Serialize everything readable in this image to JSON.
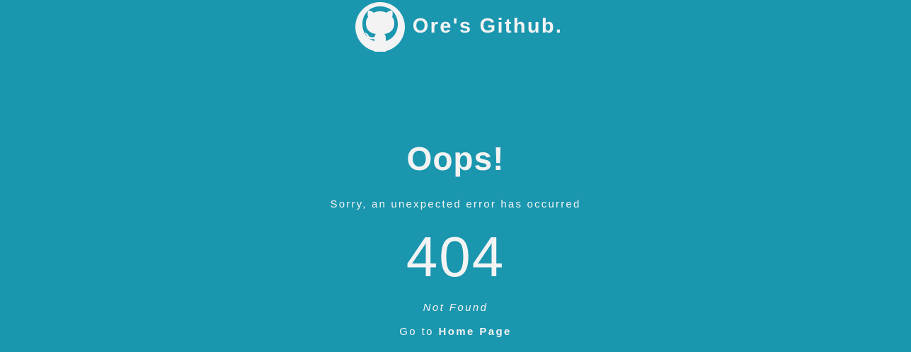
{
  "header": {
    "logo_icon": "github-octocat-icon",
    "title": "Ore's Github."
  },
  "error": {
    "heading": "Oops!",
    "message": "Sorry, an unexpected error has occurred",
    "code": "404",
    "status_text": "Not Found",
    "goto_prefix": "Go to",
    "home_link_label": "Home Page"
  },
  "colors": {
    "background": "#1a96af",
    "text": "#f3f3f3"
  }
}
